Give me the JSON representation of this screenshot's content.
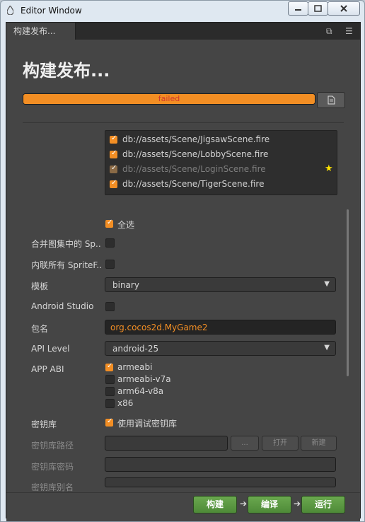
{
  "window": {
    "title": "Editor Window"
  },
  "tab": {
    "label": "构建发布..."
  },
  "heading": "构建发布...",
  "progress": {
    "status": "failed",
    "percent": 100
  },
  "scenes": [
    {
      "path": "db://assets/Scene/JigsawScene.fire",
      "checked": true,
      "disabled": false
    },
    {
      "path": "db://assets/Scene/LobbyScene.fire",
      "checked": true,
      "disabled": false
    },
    {
      "path": "db://assets/Scene/LoginScene.fire",
      "checked": true,
      "disabled": true
    },
    {
      "path": "db://assets/Scene/TigerScene.fire",
      "checked": true,
      "disabled": false
    }
  ],
  "select_all": {
    "label": "全选",
    "checked": true
  },
  "fields": {
    "merge_atlas_label": "合并图集中的 Sp..",
    "inline_sprite_label": "内联所有 SpriteF..",
    "template_label": "模板",
    "template_value": "binary",
    "android_studio_label": "Android Studio",
    "package_label": "包名",
    "package_value": "org.cocos2d.MyGame2",
    "api_level_label": "API Level",
    "api_level_value": "android-25",
    "app_abi_label": "APP ABI",
    "abi_options": [
      {
        "label": "armeabi",
        "checked": true
      },
      {
        "label": "armeabi-v7a",
        "checked": false
      },
      {
        "label": "arm64-v8a",
        "checked": false
      },
      {
        "label": "x86",
        "checked": false
      }
    ],
    "keystore_label": "密钥库",
    "use_debug_keystore": "使用调试密钥库",
    "keystore_path_label": "密钥库路径",
    "keystore_password_label": "密钥库密码",
    "keystore_alias_label": "密钥库别名",
    "browse_button": "...",
    "open_button": "打开",
    "new_button": "新建"
  },
  "actions": {
    "build": "构建",
    "compile": "编译",
    "run": "运行"
  },
  "colors": {
    "accent": "#f28e24",
    "error_text": "#d0392b",
    "action_green": "#5a9a43"
  }
}
